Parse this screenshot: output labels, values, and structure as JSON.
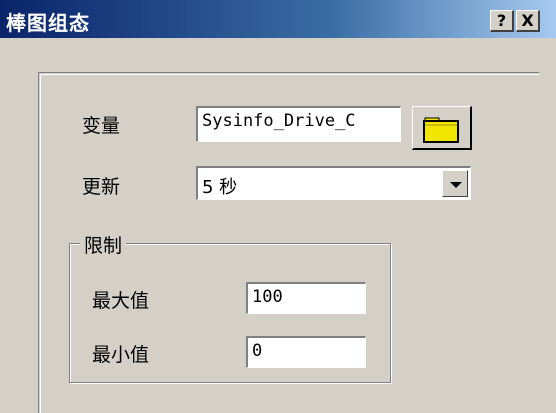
{
  "window": {
    "title": "棒图组态",
    "help_label": "?",
    "close_label": "X"
  },
  "variable": {
    "label": "变量",
    "value": "Sysinfo_Drive_C"
  },
  "update": {
    "label": "更新",
    "value": "5 秒"
  },
  "limits": {
    "title": "限制",
    "max_label": "最大值",
    "max_value": "100",
    "min_label": "最小值",
    "min_value": "0"
  },
  "icons": {
    "browse": "folder-icon",
    "dropdown": "chevron-down-icon"
  },
  "colors": {
    "titlebar_start": "#0a246a",
    "titlebar_end": "#a6caf0",
    "face": "#d4d0c8",
    "folder": "#f2e600"
  }
}
